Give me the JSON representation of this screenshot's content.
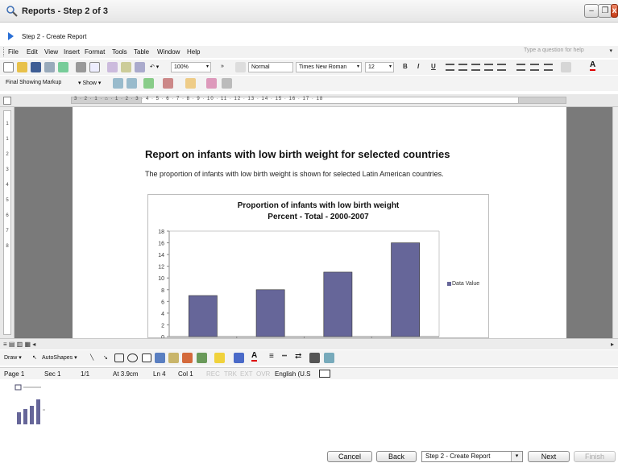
{
  "window": {
    "title": "Reports - Step 2 of 3",
    "minimize_icon": "minimize-icon",
    "maximize_icon": "maximize-icon",
    "close_icon": "close-icon"
  },
  "step": {
    "label": "Step 2 - Create Report"
  },
  "menu": [
    "File",
    "Edit",
    "View",
    "Insert",
    "Format",
    "Tools",
    "Table",
    "Window",
    "Help"
  ],
  "help_box": {
    "placeholder": "Type a question for help"
  },
  "toolbar": {
    "zoom": "100%",
    "style": "Normal",
    "font": "Times New Roman",
    "font_size": "12",
    "bold": "B",
    "italic": "I",
    "underline": "U"
  },
  "review": {
    "markup": "Final Showing Markup",
    "show": "Show"
  },
  "ruler": {
    "numbers": "3 · 2 · 1 · ⌂ · 1 · 2 · 3 · 4 · 5 · 6 · 7 · 8 · 9 · 10 · 11 · 12 · 13 · 14 · 15 · 16 · 17 · 18",
    "vertical": [
      "1",
      "1",
      "2",
      "3",
      "4",
      "5",
      "6",
      "7",
      "8"
    ]
  },
  "document": {
    "heading": "Report on infants with low birth weight for selected countries",
    "body": "The proportion of infants with low birth weight is shown for selected Latin American countries."
  },
  "chart_data": {
    "type": "bar",
    "title": "Proportion of infants with low birth weight",
    "subtitle": "Percent - Total - 2000-2007",
    "categories": [
      "",
      "",
      "",
      ""
    ],
    "series": [
      {
        "name": "Data Value",
        "values": [
          7,
          8,
          11,
          16
        ]
      }
    ],
    "yticks": [
      "0",
      "2",
      "4",
      "6",
      "8",
      "10",
      "12",
      "14",
      "16",
      "18"
    ],
    "ylim": [
      0,
      18
    ],
    "grid": false,
    "legend": "right",
    "bar_color": "#666699"
  },
  "drawing": {
    "draw": "Draw",
    "autoshapes": "AutoShapes"
  },
  "status": {
    "page": "Page 1",
    "sec": "Sec 1",
    "pages": "1/1",
    "at": "At 3.9cm",
    "ln": "Ln 4",
    "col": "Col 1",
    "rec": "REC",
    "trk": "TRK",
    "ext": "EXT",
    "ovr": "OVR",
    "lang": "English (U.S"
  },
  "wizard": {
    "cancel": "Cancel",
    "back": "Back",
    "step_select": "Step 2 - Create Report",
    "next": "Next",
    "finish": "Finish"
  }
}
